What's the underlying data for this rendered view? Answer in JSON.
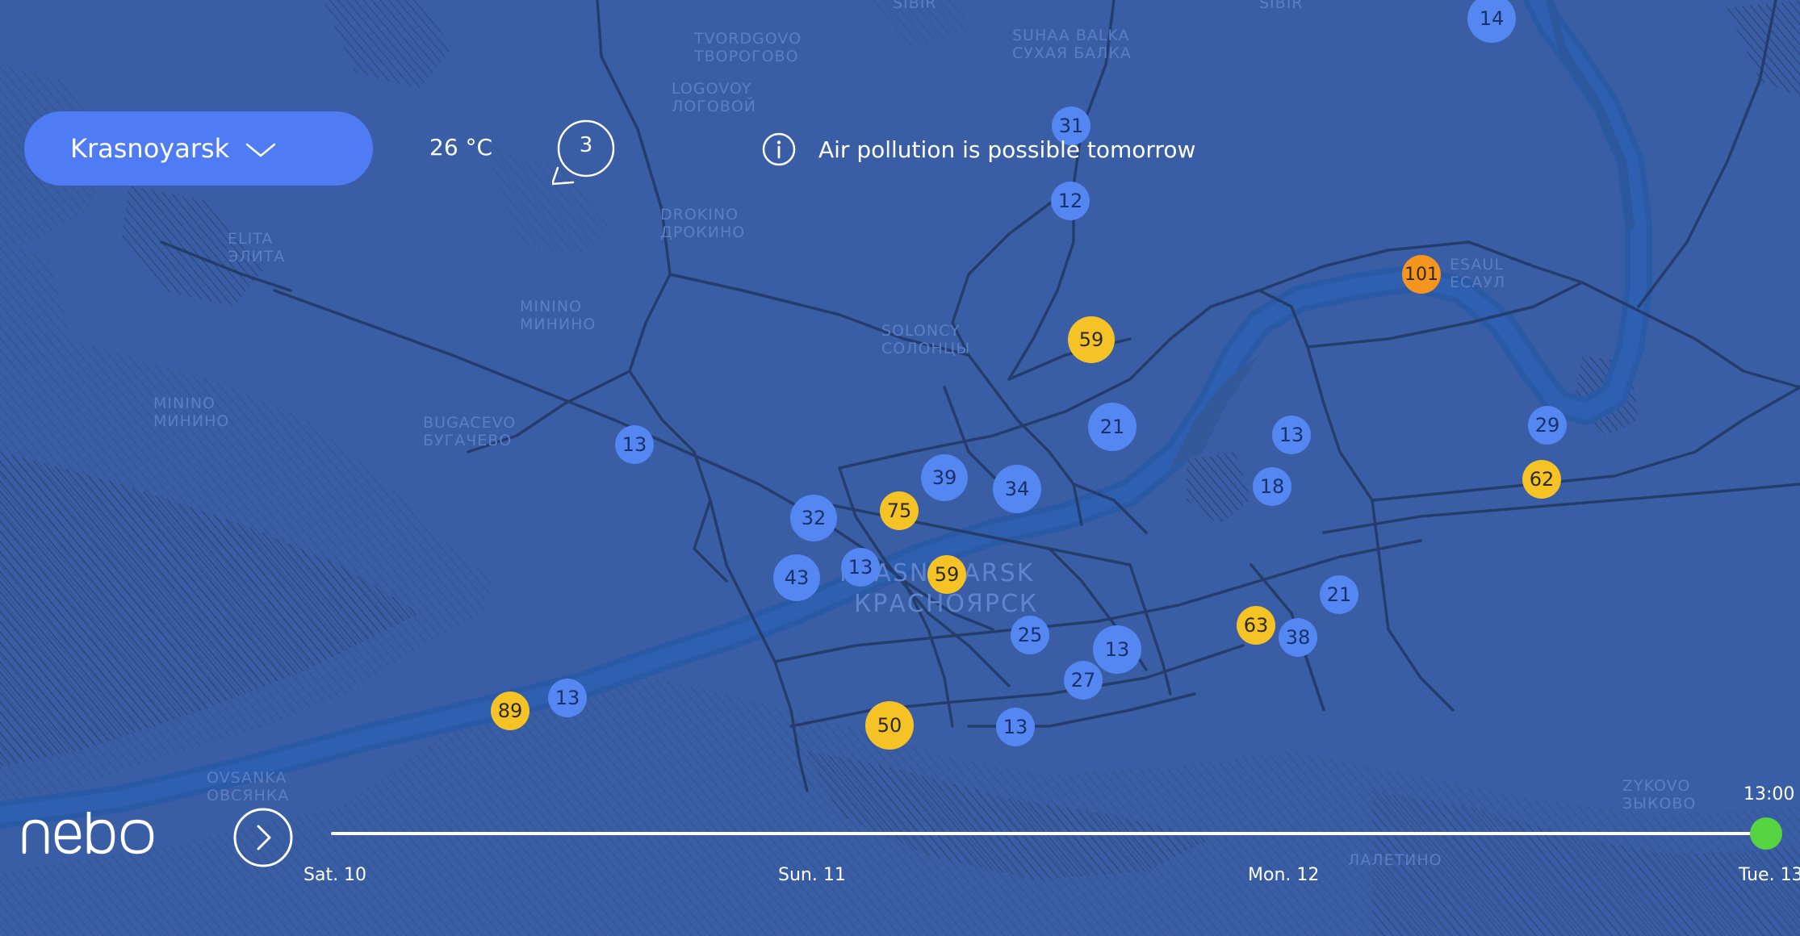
{
  "header": {
    "city": "Krasnoyarsk",
    "temperature": "26 °C",
    "timer_value": "3",
    "notice": "Air pollution is possible tomorrow"
  },
  "map": {
    "place_labels": [
      "TVORDGOVO",
      "ТВОРОГОВО",
      "LOGOVOY",
      "ЛОГОВОЙ",
      "SUHAA BALKA",
      "СУХАЯ БАЛКА",
      "DROKINO",
      "ДРОКИНО",
      "ELITA",
      "ЭЛИТА",
      "MININO",
      "МИНИНО",
      "SOLONCY",
      "СОЛОНЦЫ",
      "MININO",
      "МИНИНО",
      "BUGACEVO",
      "БУГАЧЕВО",
      "ESAUL",
      "ЕСАУЛ",
      "OVSANKA",
      "ОВСЯНКА",
      "ZYKOVO",
      "ЗЫКОВО",
      "SIBIR",
      "SIBIR",
      "ЛАЛЕТИНО"
    ],
    "city_label": "KRASNOYARSK",
    "city_label_ru": "КРАСНОЯРСК"
  },
  "markers": [
    {
      "value": "14",
      "level": "low"
    },
    {
      "value": "31",
      "level": "low"
    },
    {
      "value": "12",
      "level": "low"
    },
    {
      "value": "101",
      "level": "high"
    },
    {
      "value": "59",
      "level": "medium"
    },
    {
      "value": "13",
      "level": "low"
    },
    {
      "value": "21",
      "level": "low"
    },
    {
      "value": "13",
      "level": "low"
    },
    {
      "value": "29",
      "level": "low"
    },
    {
      "value": "62",
      "level": "medium"
    },
    {
      "value": "39",
      "level": "low"
    },
    {
      "value": "34",
      "level": "low"
    },
    {
      "value": "18",
      "level": "low"
    },
    {
      "value": "32",
      "level": "low"
    },
    {
      "value": "75",
      "level": "medium"
    },
    {
      "value": "43",
      "level": "low"
    },
    {
      "value": "13",
      "level": "low"
    },
    {
      "value": "59",
      "level": "medium"
    },
    {
      "value": "21",
      "level": "low"
    },
    {
      "value": "25",
      "level": "low"
    },
    {
      "value": "13",
      "level": "low"
    },
    {
      "value": "63",
      "level": "medium"
    },
    {
      "value": "38",
      "level": "low"
    },
    {
      "value": "27",
      "level": "low"
    },
    {
      "value": "13",
      "level": "low"
    },
    {
      "value": "89",
      "level": "medium"
    },
    {
      "value": "50",
      "level": "medium"
    },
    {
      "value": "13",
      "level": "low"
    }
  ],
  "level_colors": {
    "low": "#5487f2",
    "medium": "#f6c327",
    "high": "#f5951e"
  },
  "timeline": {
    "current_time": "13:00",
    "days": [
      "Sat. 10",
      "Sun. 11",
      "Mon. 12",
      "Tue. 13"
    ]
  },
  "logo": "nebo"
}
